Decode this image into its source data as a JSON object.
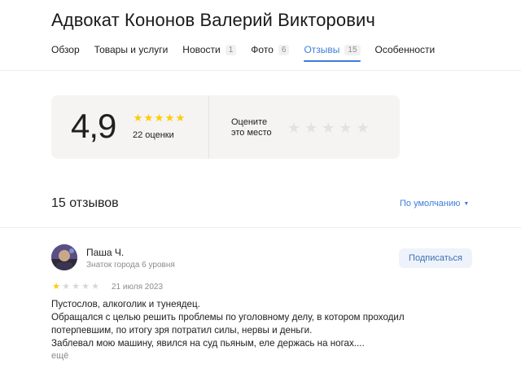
{
  "page_title": "Адвокат Кононов Валерий Викторович",
  "tabs": [
    {
      "label": "Обзор",
      "count": ""
    },
    {
      "label": "Товары и услуги",
      "count": ""
    },
    {
      "label": "Новости",
      "count": "1"
    },
    {
      "label": "Фото",
      "count": "6"
    },
    {
      "label": "Отзывы",
      "count": "15",
      "active": true
    },
    {
      "label": "Особенности",
      "count": ""
    }
  ],
  "rating": {
    "score": "4,9",
    "stars": 5,
    "count_label": "22 оценки",
    "rate_prompt_line1": "Оцените",
    "rate_prompt_line2": "это место",
    "star_color": "#ffcc00"
  },
  "reviews_section": {
    "heading": "15 отзывов",
    "sort_label": "По умолчанию",
    "sort_icon": "caret-down-icon"
  },
  "review": {
    "author": "Паша Ч.",
    "level": "Знаток города 6 уровня",
    "subscribe_label": "Подписаться",
    "stars": 1,
    "date": "21 июля 2023",
    "lines": [
      "Пустослов, алкоголик и тунеядец.",
      "Обращался с целью решить проблемы по уголовному делу, в котором проходил",
      "потерпевшим, по итогу зря потратил силы, нервы и деньги.",
      "Заблевал мою машину, явился на суд пьяным, еле держась на ногах...."
    ],
    "more_label": "ещё"
  },
  "accent_color": "#3d7dd9"
}
